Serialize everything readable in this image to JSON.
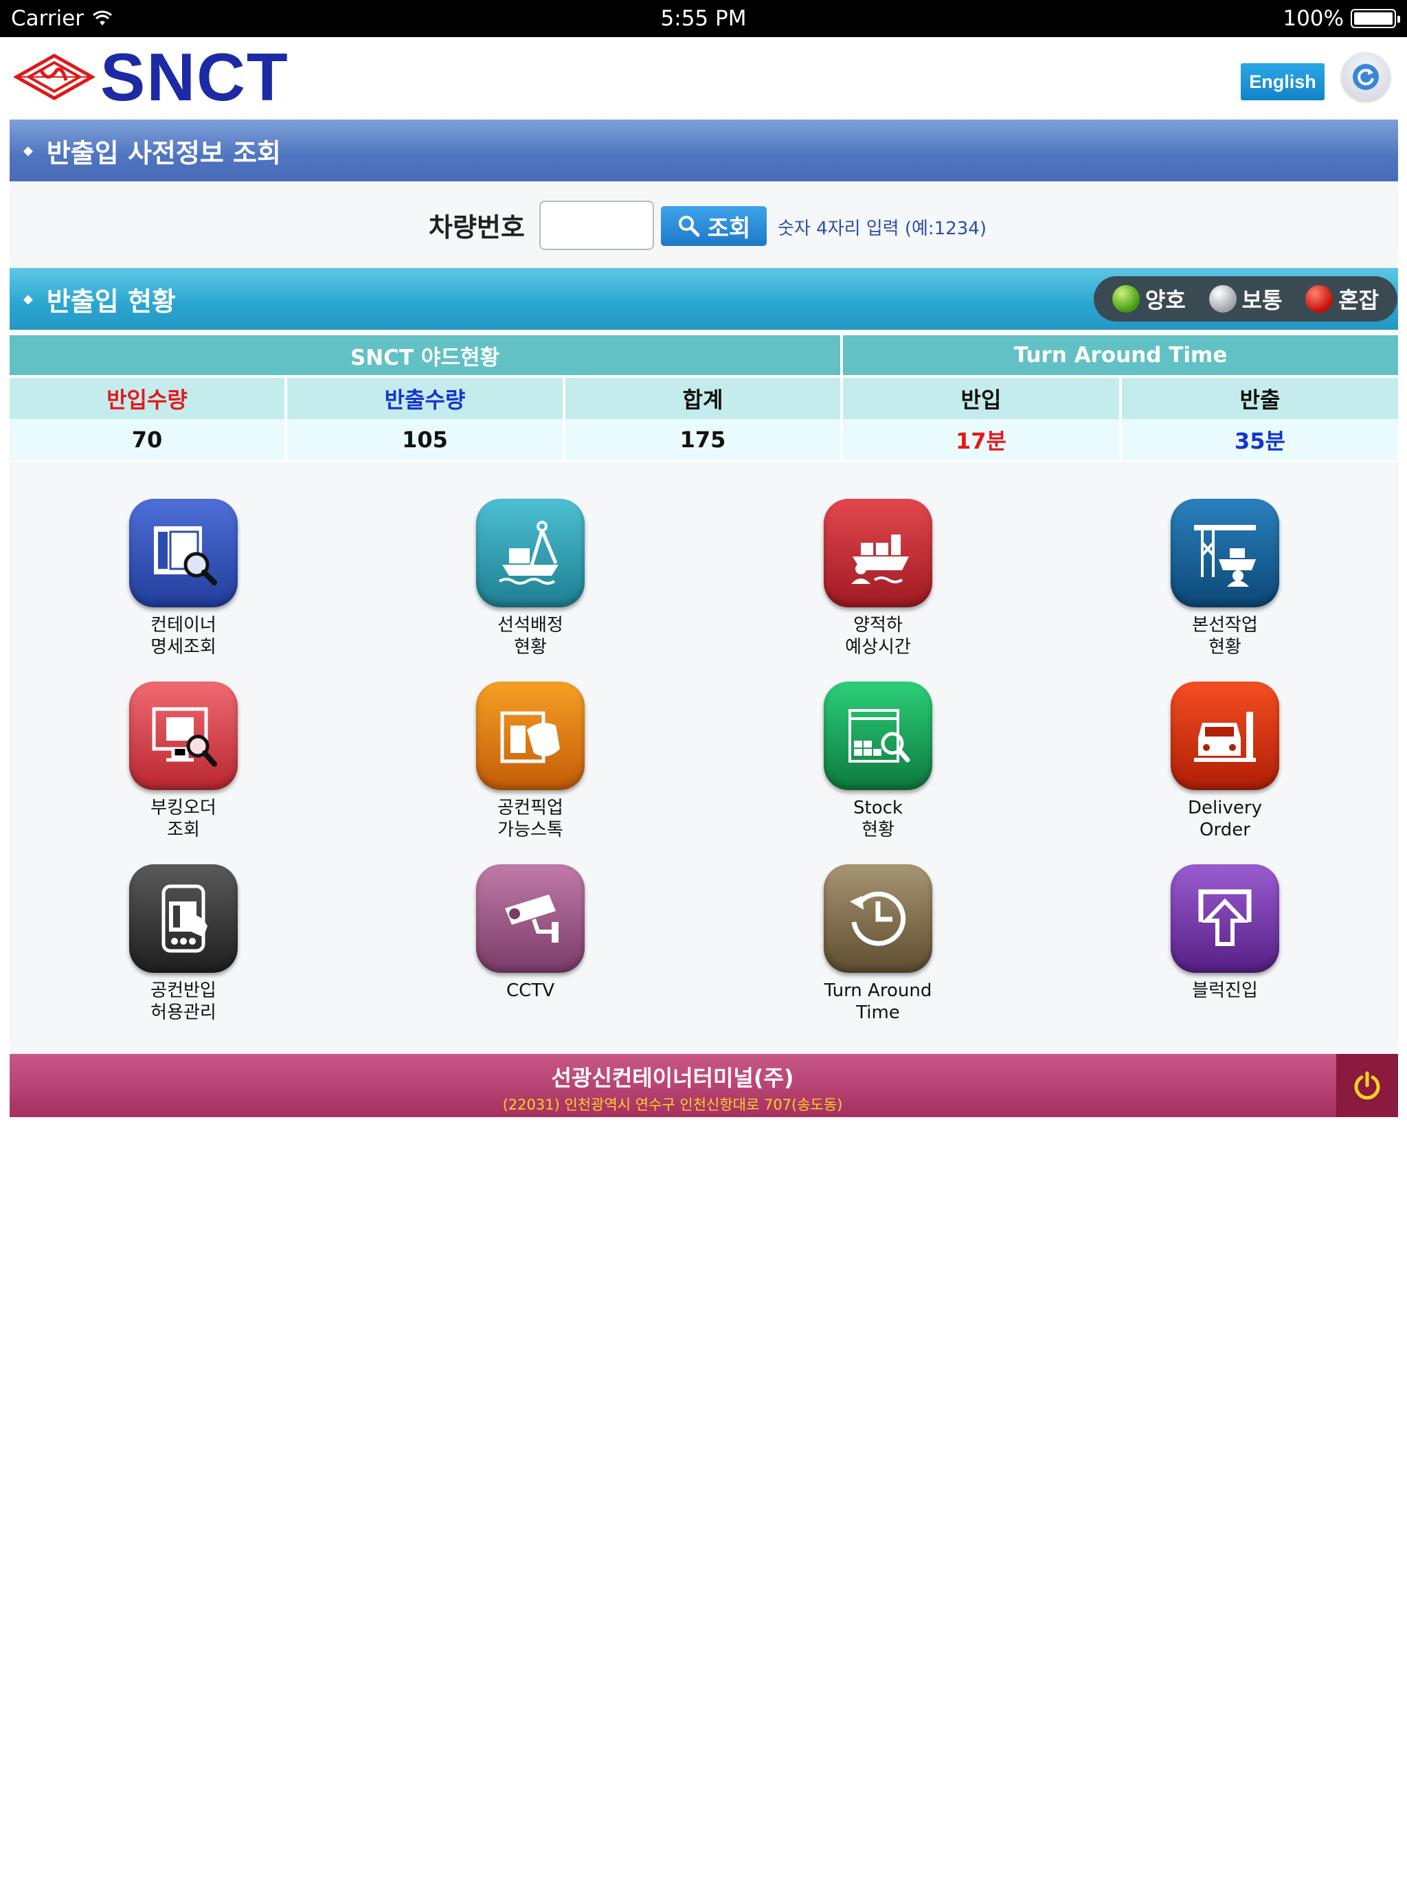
{
  "status_bar": {
    "carrier": "Carrier",
    "time": "5:55 PM",
    "battery": "100%"
  },
  "header": {
    "logo_text": "SNCT",
    "english_button": "English",
    "refresh_icon": "refresh-icon"
  },
  "pre_info": {
    "title": "반출입 사전정보 조회",
    "vehicle_label": "차량번호",
    "input_value": "",
    "search_button": "조회",
    "hint": "숫자 4자리 입력 (예:1234)"
  },
  "status": {
    "title": "반출입 현황",
    "legend": [
      {
        "label": "양호",
        "color": "#4caf20"
      },
      {
        "label": "보통",
        "color": "#b0b4b8"
      },
      {
        "label": "혼잡",
        "color": "#d01010"
      }
    ]
  },
  "table": {
    "group_yard": "SNCT 야드현황",
    "group_tat": "Turn Around Time",
    "headers": [
      "반입수량",
      "반출수량",
      "합계",
      "반입",
      "반출"
    ],
    "values": [
      "70",
      "105",
      "175",
      "17분",
      "35분"
    ]
  },
  "apps": [
    {
      "label1": "컨테이너",
      "label2": "명세조회",
      "icon": "container-search-icon",
      "color": "#2b4cb0"
    },
    {
      "label1": "선석배정",
      "label2": "현황",
      "icon": "berth-compass-icon",
      "color": "#2a9eb2"
    },
    {
      "label1": "양적하",
      "label2": "예상시간",
      "icon": "ship-cargo-icon",
      "color": "#c8262e"
    },
    {
      "label1": "본선작업",
      "label2": "현황",
      "icon": "crane-ship-icon",
      "color": "#16659a"
    },
    {
      "label1": "부킹오더",
      "label2": "조회",
      "icon": "booking-search-icon",
      "color": "#d6414c"
    },
    {
      "label1": "공컨픽업",
      "label2": "가능스톡",
      "icon": "pickup-hand-icon",
      "color": "#e07010"
    },
    {
      "label1": "Stock",
      "label2": "현황",
      "icon": "stock-window-icon",
      "color": "#15a05a"
    },
    {
      "label1": "Delivery",
      "label2": "Order",
      "icon": "truck-gate-icon",
      "color": "#d8330d"
    },
    {
      "label1": "공컨반입",
      "label2": "허용관리",
      "icon": "phone-container-icon",
      "color": "#3a3a3a"
    },
    {
      "label1": "CCTV",
      "label2": "",
      "icon": "cctv-camera-icon",
      "color": "#9a5a86"
    },
    {
      "label1": "Turn Around",
      "label2": "Time",
      "icon": "clock-arrow-icon",
      "color": "#7d6a48"
    },
    {
      "label1": "블럭진입",
      "label2": "",
      "icon": "upload-arrow-icon",
      "color": "#7a3aa8"
    }
  ],
  "footer": {
    "company": "선광신컨테이너터미널(주)",
    "address": "(22031) 인천광역시 연수구 인천신항대로 707(송도동)",
    "power_icon": "power-icon"
  }
}
